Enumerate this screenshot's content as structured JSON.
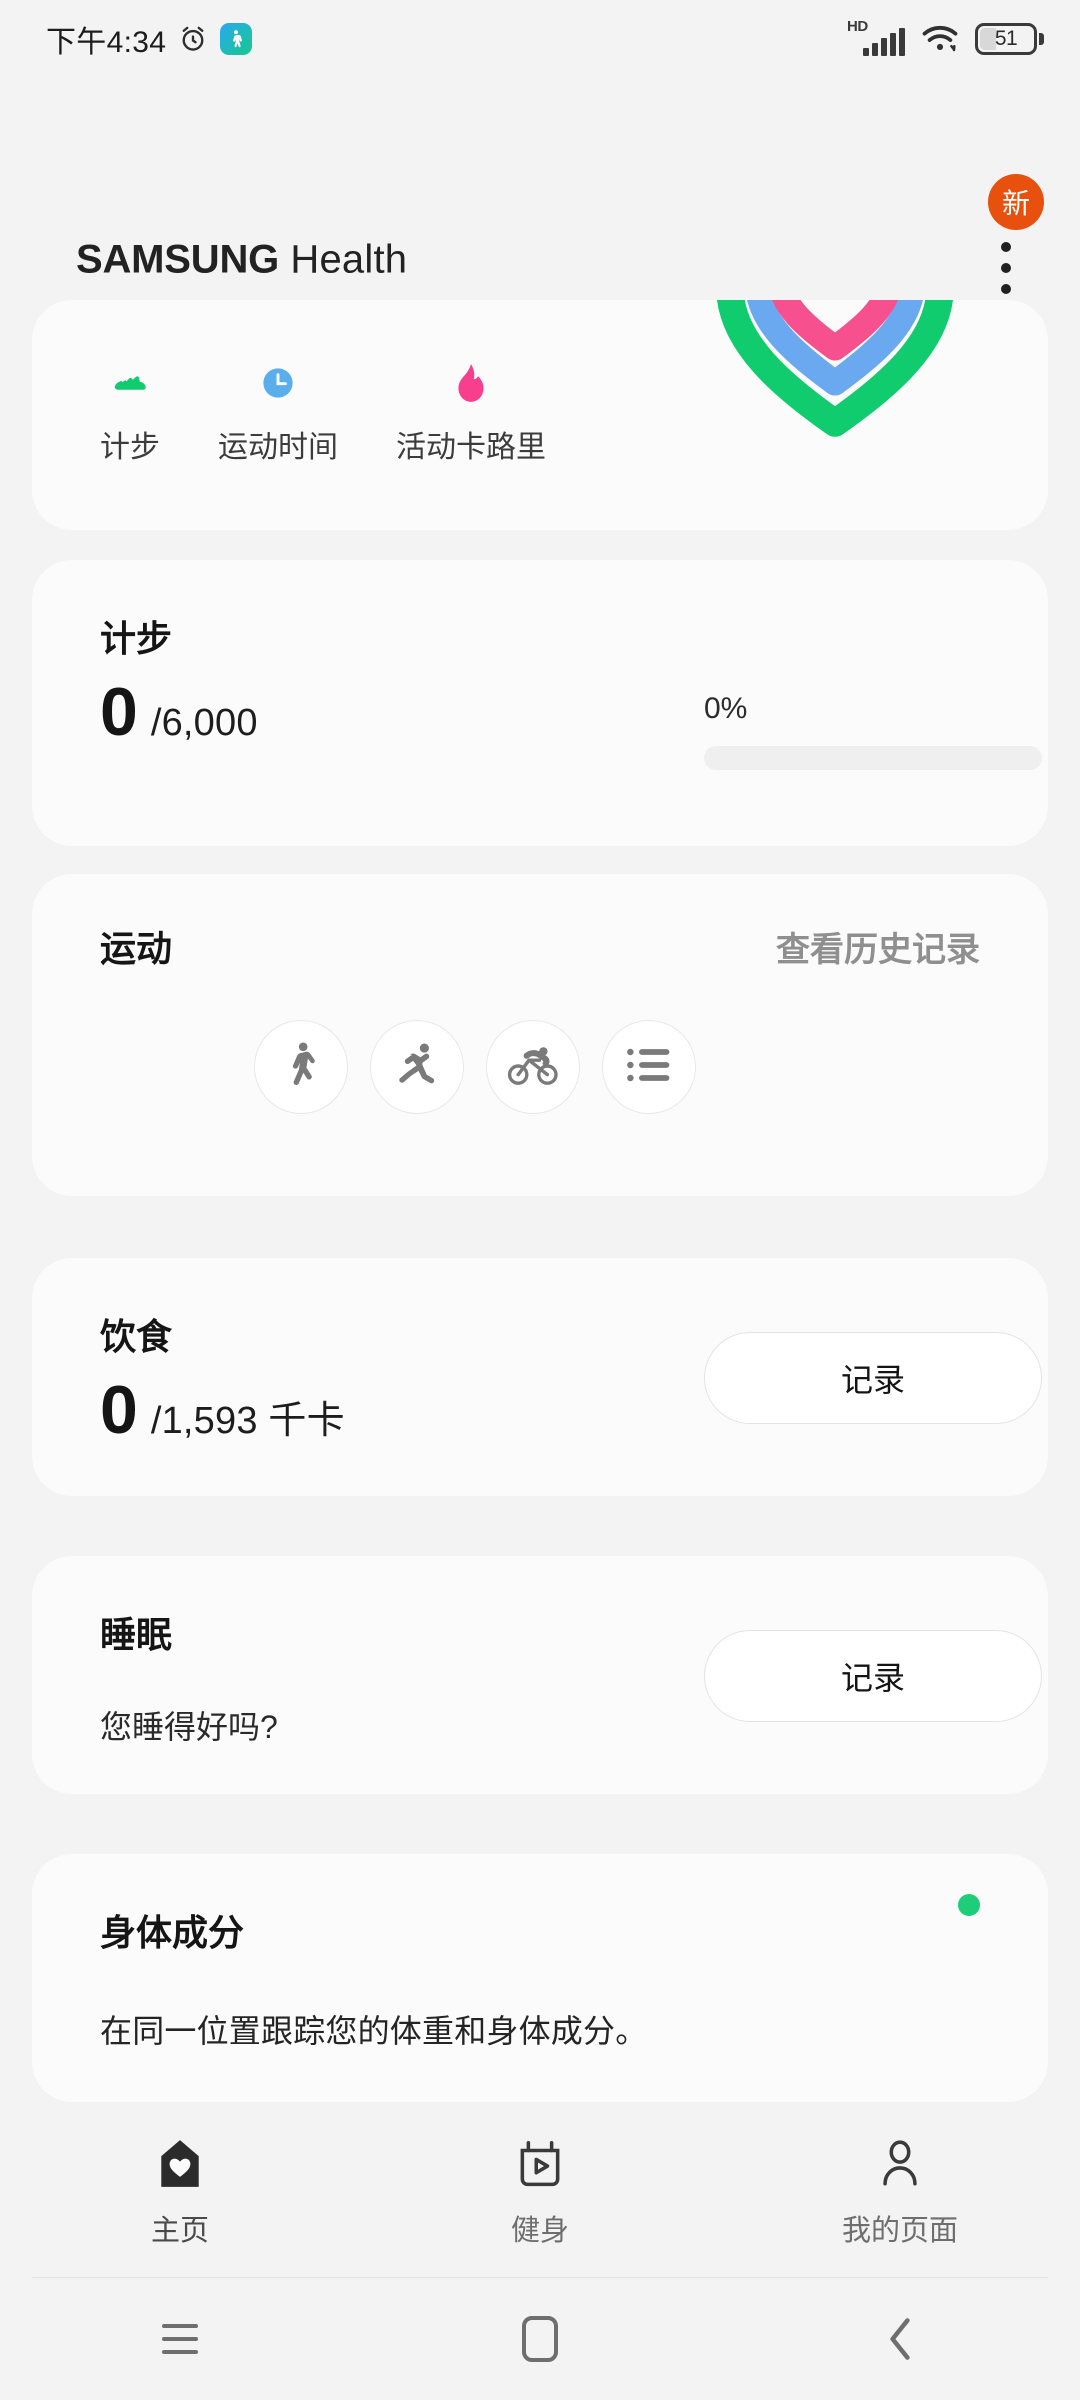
{
  "status_bar": {
    "time": "下午4:34",
    "alarm_icon": "alarm-icon",
    "app_icon": "fitness-app-icon",
    "network_label": "HD",
    "signal_icon": "signal-bars-icon",
    "wifi_icon": "wifi-icon",
    "battery_level": "51"
  },
  "header": {
    "brand": "SAMSUNG",
    "product": "Health",
    "new_badge": "新",
    "overflow_icon": "more-options-icon"
  },
  "activity_card": {
    "metrics": [
      {
        "label": "计步",
        "icon": "shoe-icon",
        "color": "#11CC6E"
      },
      {
        "label": "运动时间",
        "icon": "clock-icon",
        "color": "#5AAEEB"
      },
      {
        "label": "活动卡路里",
        "icon": "flame-icon",
        "color": "#F73F8E"
      }
    ],
    "rings": {
      "icon": "heart-rings-icon",
      "outer_color": "#11CC6E",
      "middle_color": "#6AA8F0",
      "inner_color": "#F7508F"
    }
  },
  "steps_card": {
    "title": "计步",
    "value": "0",
    "goal": "/6,000",
    "percent_label": "0%",
    "percent_value": 0,
    "bar_color": "#1ECD79"
  },
  "exercise_card": {
    "title": "运动",
    "history_link": "查看历史记录",
    "buttons": [
      {
        "name": "walking",
        "icon": "walking-icon"
      },
      {
        "name": "running",
        "icon": "running-icon"
      },
      {
        "name": "cycling",
        "icon": "cycling-icon"
      },
      {
        "name": "more",
        "icon": "list-icon"
      }
    ]
  },
  "food_card": {
    "title": "饮食",
    "value": "0",
    "goal": "/1,593 千卡",
    "action_label": "记录"
  },
  "sleep_card": {
    "title": "睡眠",
    "subtitle": "您睡得好吗?",
    "action_label": "记录"
  },
  "body_card": {
    "title": "身体成分",
    "description": "在同一位置跟踪您的体重和身体成分。",
    "indicator_color": "#1ECD79"
  },
  "bottom_nav": {
    "items": [
      {
        "label": "主页",
        "icon": "home-heart-icon",
        "active": true
      },
      {
        "label": "健身",
        "icon": "fitness-play-icon",
        "active": false
      },
      {
        "label": "我的页面",
        "icon": "person-icon",
        "active": false
      }
    ]
  },
  "system_nav": {
    "recents": "recents-icon",
    "home": "home-square-icon",
    "back": "back-chevron-icon"
  }
}
